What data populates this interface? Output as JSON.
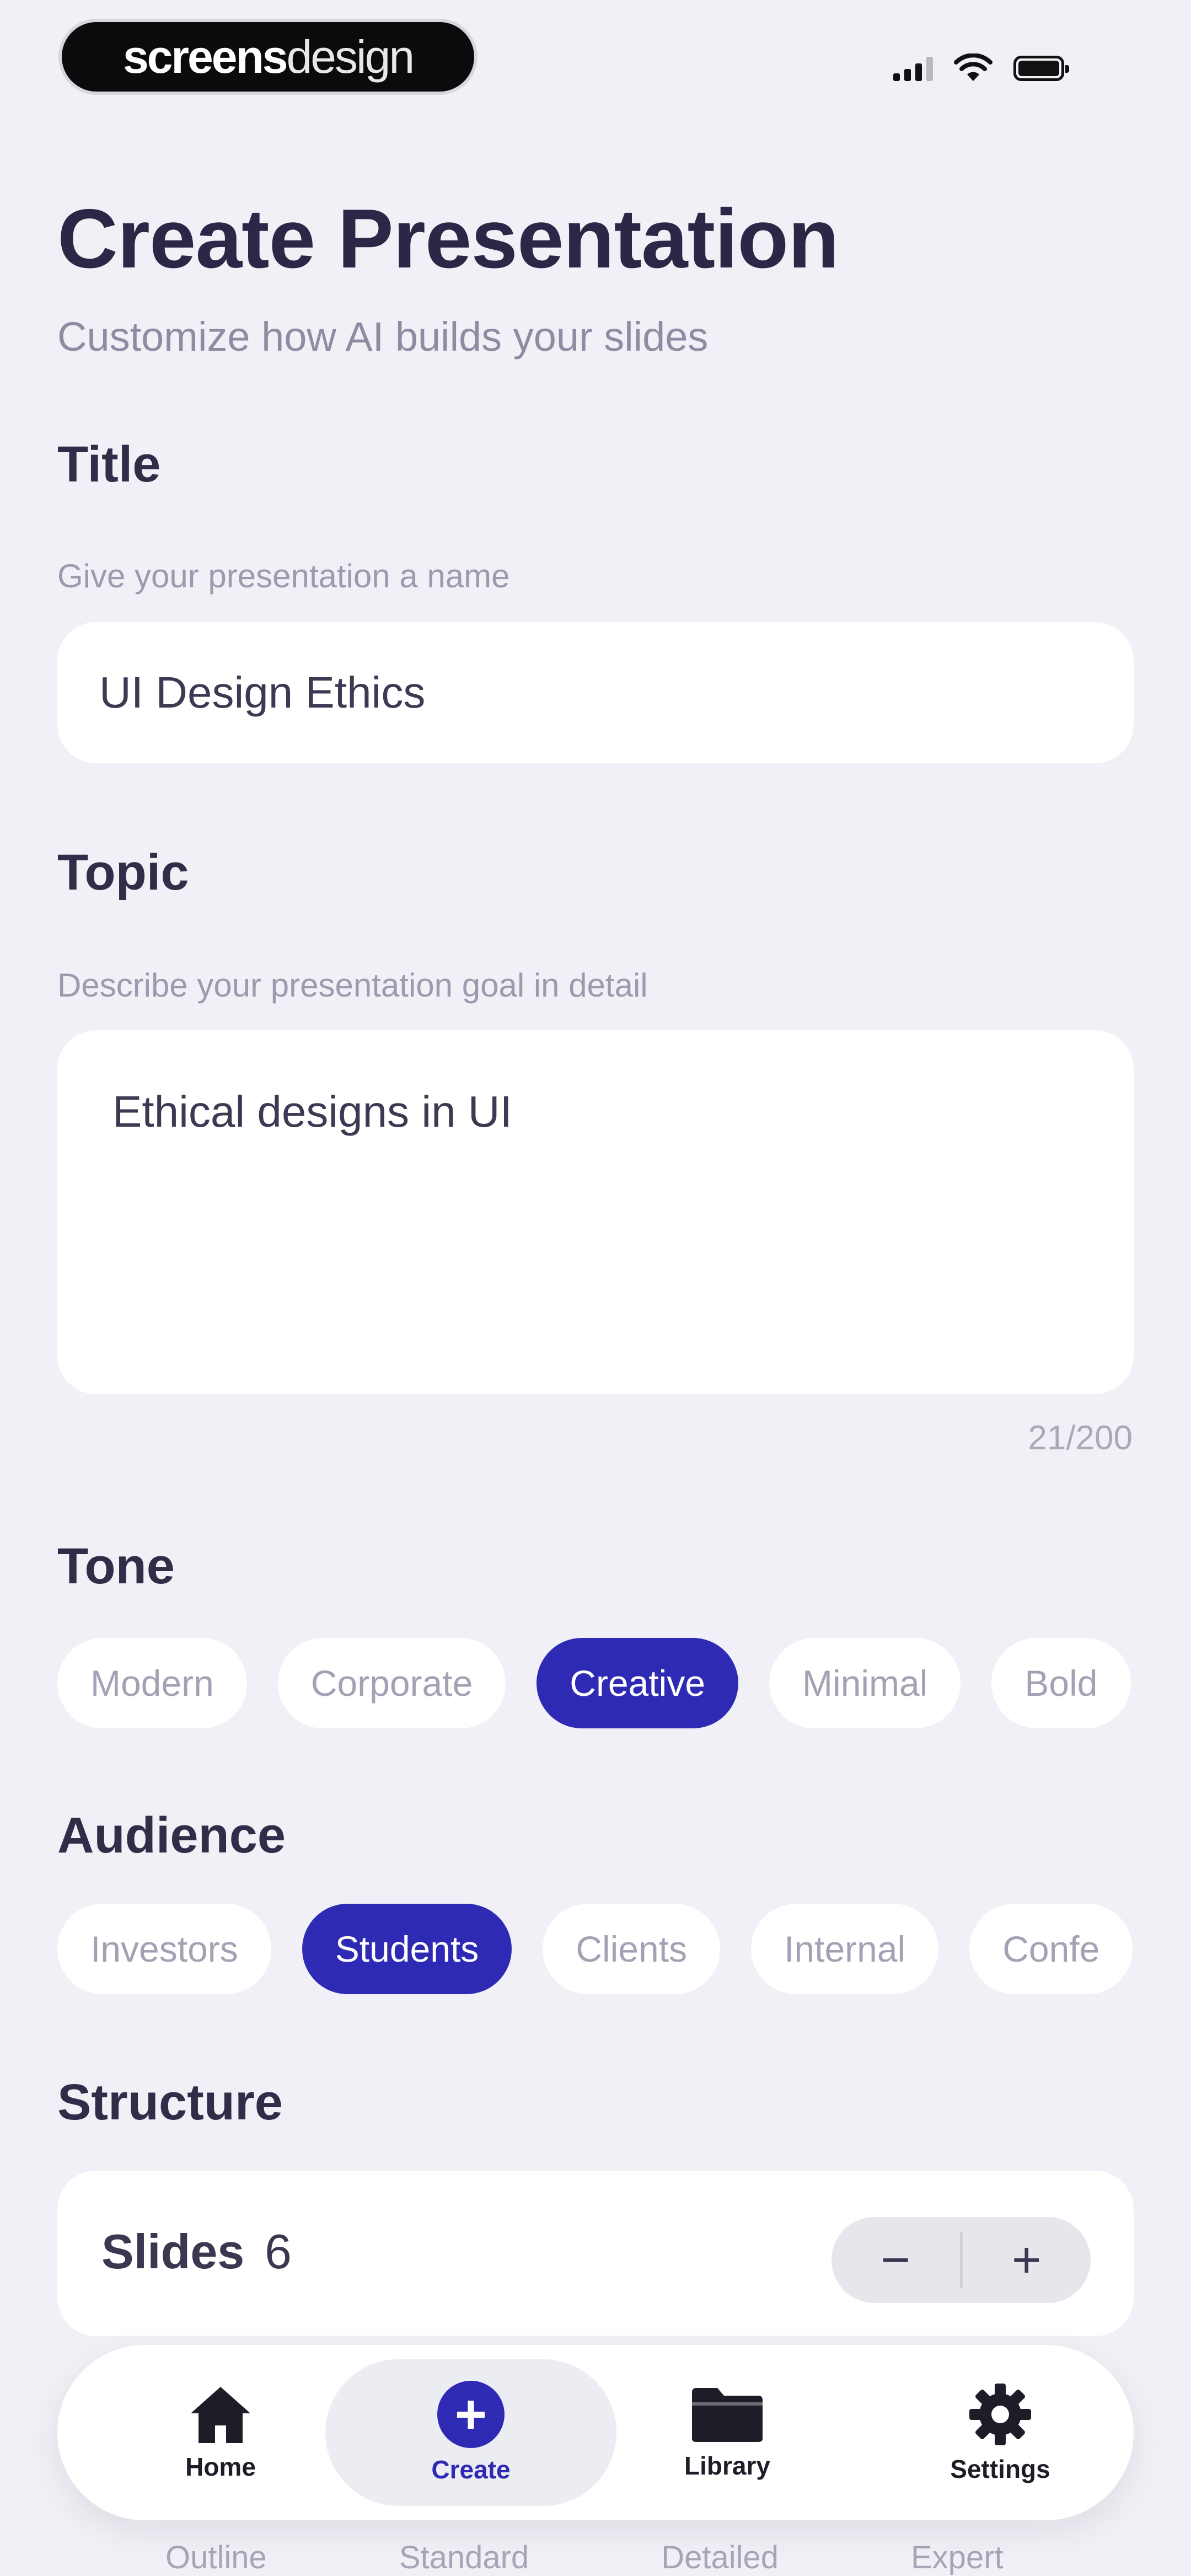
{
  "status_bar": {
    "brand_bold": "screens",
    "brand_light": "design"
  },
  "header": {
    "title": "Create Presentation",
    "subtitle": "Customize how AI builds your slides"
  },
  "title_section": {
    "label": "Title",
    "hint": "Give your presentation a name",
    "value": "UI Design Ethics"
  },
  "topic_section": {
    "label": "Topic",
    "hint": "Describe your presentation goal in detail",
    "value": "Ethical designs in UI",
    "counter": "21/200"
  },
  "tone": {
    "label": "Tone",
    "options": [
      "Modern",
      "Corporate",
      "Creative",
      "Minimal",
      "Bold"
    ],
    "selected": "Creative"
  },
  "audience": {
    "label": "Audience",
    "options": [
      "Investors",
      "Students",
      "Clients",
      "Internal",
      "Confe"
    ],
    "selected": "Students"
  },
  "structure": {
    "label": "Structure",
    "slides_label": "Slides",
    "slides_count": "6",
    "decrement": "−",
    "increment": "+",
    "obscured_options": [
      "Outline",
      "Standard",
      "Detailed",
      "Expert"
    ]
  },
  "tabbar": {
    "home": "Home",
    "create": "Create",
    "library": "Library",
    "settings": "Settings",
    "active": "Create"
  },
  "colors": {
    "accent": "#2f2ab4",
    "background": "#f0f0f6",
    "title": "#2a2846"
  }
}
